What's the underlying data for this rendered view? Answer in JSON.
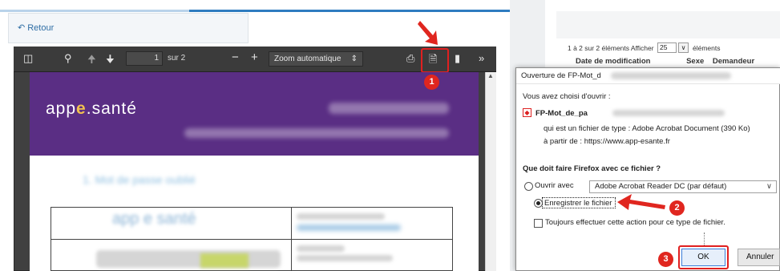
{
  "left": {
    "back_link": "Retour",
    "viewer": {
      "page_number": "1",
      "page_total": "sur 2",
      "zoom": "Zoom automatique",
      "zoom_minus": "−",
      "zoom_plus": "+"
    },
    "pdf": {
      "logo_text": "app",
      "logo_e": "e",
      "logo_rest": ".santé",
      "section_heading": "1. Mot de passe oublié",
      "table_logo": "app e santé"
    }
  },
  "background_page": {
    "list_info": "1 à 2 sur 2 éléments  Afficher",
    "page_size": "25",
    "elements_label": "éléments",
    "columns": [
      "Date de modification",
      "Sexe",
      "Demandeur"
    ]
  },
  "dialog": {
    "title": "Ouverture de FP-Mot_d",
    "intro": "Vous avez choisi d'ouvrir :",
    "filename": "FP-Mot_de_pa",
    "file_type": "qui est un fichier de type : Adobe Acrobat Document (390 Ko)",
    "source": "à partir de : https://www.app-esante.fr",
    "question": "Que doit faire Firefox avec ce fichier ?",
    "open_with_label": "Ouvrir avec",
    "open_with_app": "Adobe Acrobat Reader DC  (par défaut)",
    "save_label": "Enregistrer le fichier",
    "always_label": "Toujours effectuer cette action pour ce type de fichier.",
    "ok_label": "OK",
    "cancel_label": "Annuler"
  },
  "annotations": {
    "step1": "1",
    "step2": "2",
    "step3": "3",
    "color": "#e0261f"
  },
  "icons": [
    "sidebar-toggle-icon",
    "search-icon",
    "arrow-up-icon",
    "arrow-down-icon",
    "print-icon",
    "download-icon",
    "bookmark-icon",
    "tools-icon",
    "pdf-file-icon"
  ]
}
